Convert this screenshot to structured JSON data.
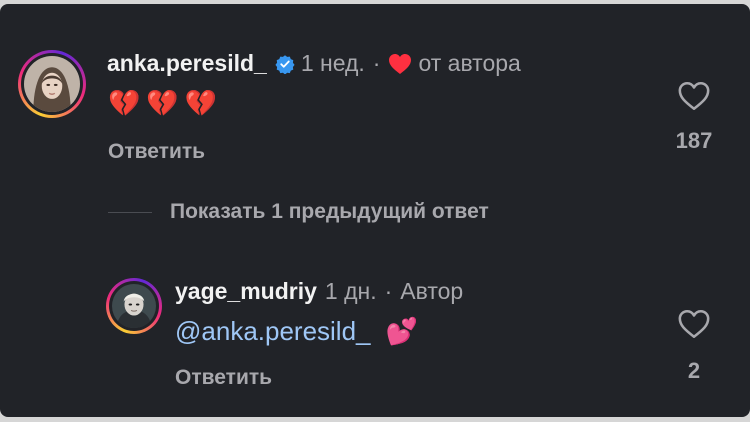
{
  "comment": {
    "username": "anka.peresild_",
    "time": "1 нед.",
    "separator": "·",
    "author_liked": "от автора",
    "text_emoji": [
      "💔",
      "💔",
      "💔"
    ],
    "reply_label": "Ответить",
    "like_count": "187"
  },
  "show_previous": "Показать 1 предыдущий ответ",
  "reply": {
    "username": "yage_mudriy",
    "time": "1 дн.",
    "separator": "·",
    "badge": "Автор",
    "mention": "@anka.peresild_",
    "emoji": "💕",
    "reply_label": "Ответить",
    "like_count": "2"
  },
  "colors": {
    "background": "#212328",
    "verified": "#3897f0",
    "liked_heart": "#ff3040",
    "mention": "#9fc7f6"
  },
  "icons": {
    "verified": "verified-badge-icon",
    "author_heart": "heart-filled-icon",
    "like": "heart-outline-icon"
  }
}
